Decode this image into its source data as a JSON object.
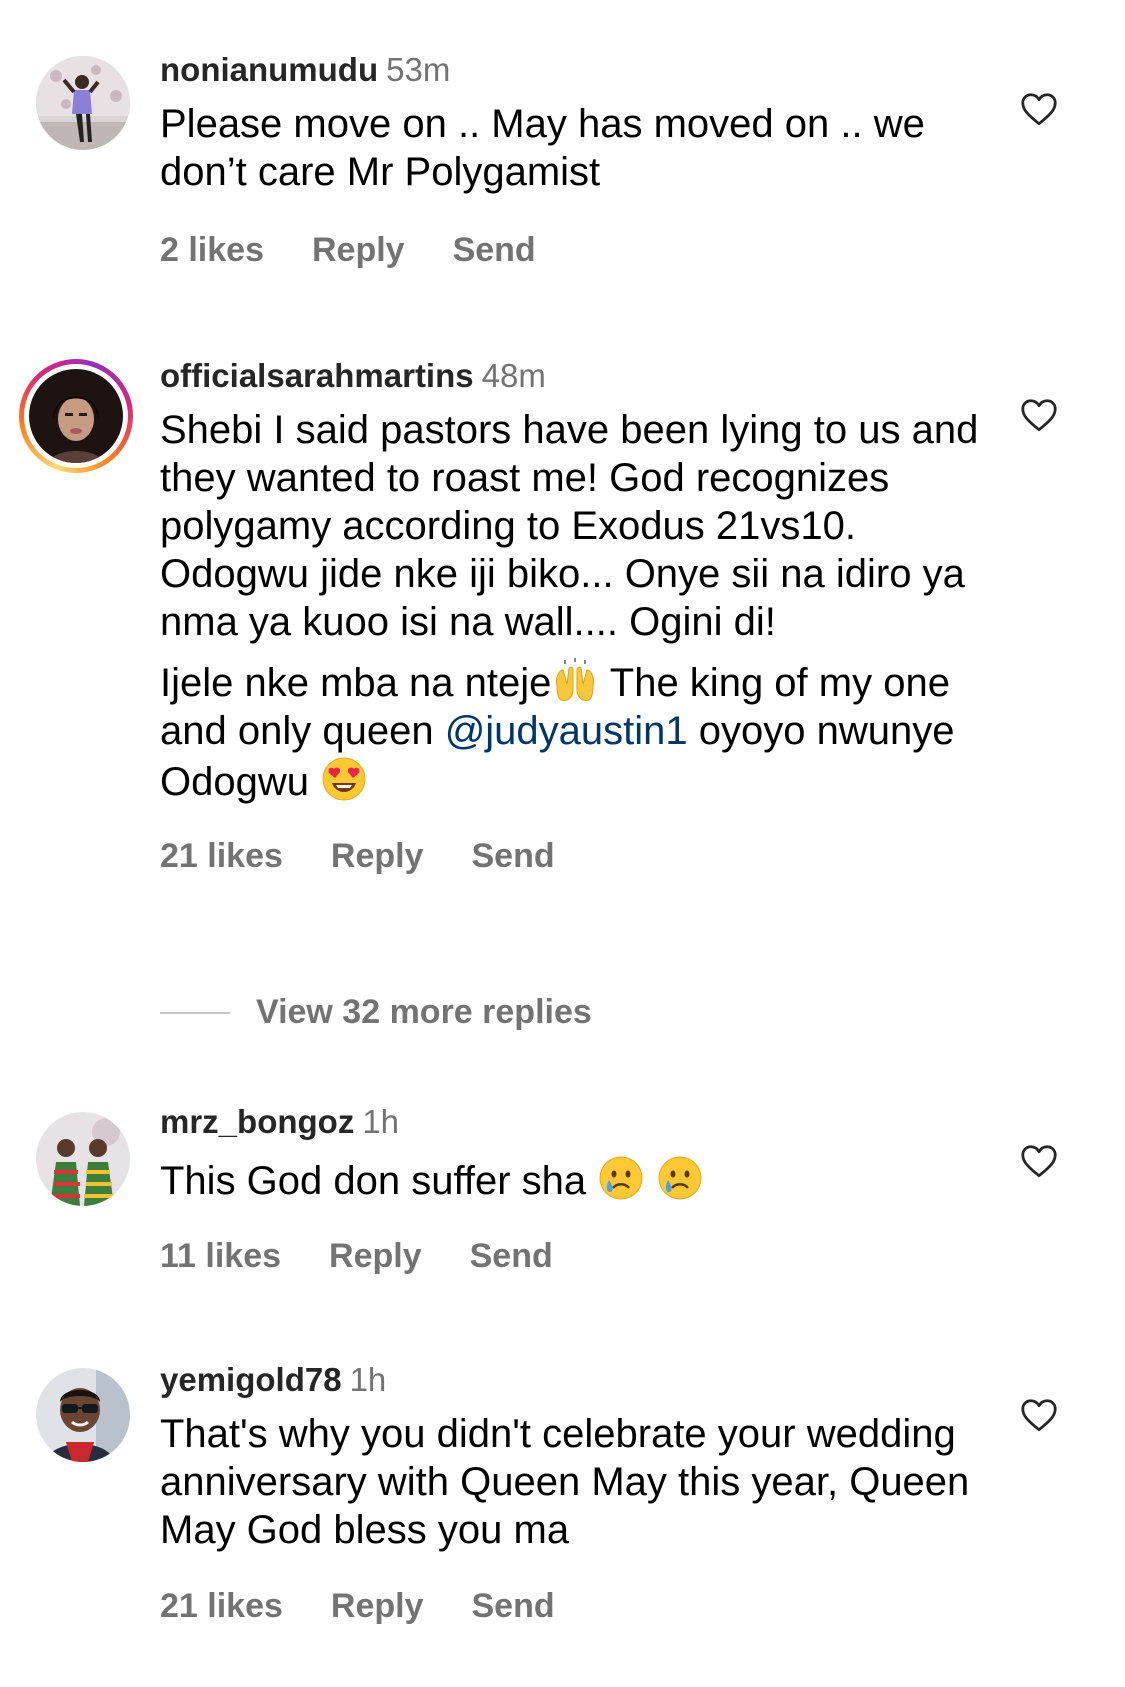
{
  "comments": [
    {
      "username": "nonianumudu",
      "time": "53m",
      "text": "Please move on .. May has moved on .. we don’t care Mr Polygamist",
      "likes": "2 likes",
      "reply": "Reply",
      "send": "Send",
      "avatar_icon": "person-photo-avatar"
    },
    {
      "username": "officialsarahmartins",
      "time": "48m",
      "text": "Shebi I said pastors have been lying to us and they wanted to roast me! God recognizes polygamy according to Exodus 21vs10. Odogwu jide nke iji biko... Onye sii na idiro ya nma ya kuoo isi na wall.... Ogini di!",
      "text2_part1": "Ijele nke mba na nteje",
      "text2_part2": " The king of my one and only queen ",
      "mention": "@judyaustin1",
      "text2_part3": " oyoyo nwunye Odogwu ",
      "likes": "21 likes",
      "reply": "Reply",
      "send": "Send",
      "avatar_icon": "woman-portrait-avatar",
      "emojis": [
        "raised-hands-emoji",
        "heart-eyes-emoji"
      ]
    },
    {
      "username": "mrz_bongoz",
      "time": "1h",
      "text": "This God don suffer sha ",
      "likes": "11 likes",
      "reply": "Reply",
      "send": "Send",
      "avatar_icon": "children-photo-avatar",
      "emojis": [
        "crying-face-emoji",
        "crying-face-emoji"
      ]
    },
    {
      "username": "yemigold78",
      "time": "1h",
      "text": "That's why you didn't celebrate your wedding anniversary with Queen May this year, Queen May God bless you ma",
      "likes": "21 likes",
      "reply": "Reply",
      "send": "Send",
      "avatar_icon": "man-sunglasses-avatar"
    }
  ],
  "view_replies": "View 32 more replies",
  "colors": {
    "username": "#262626",
    "secondary": "#737373",
    "mention": "#00376b"
  }
}
